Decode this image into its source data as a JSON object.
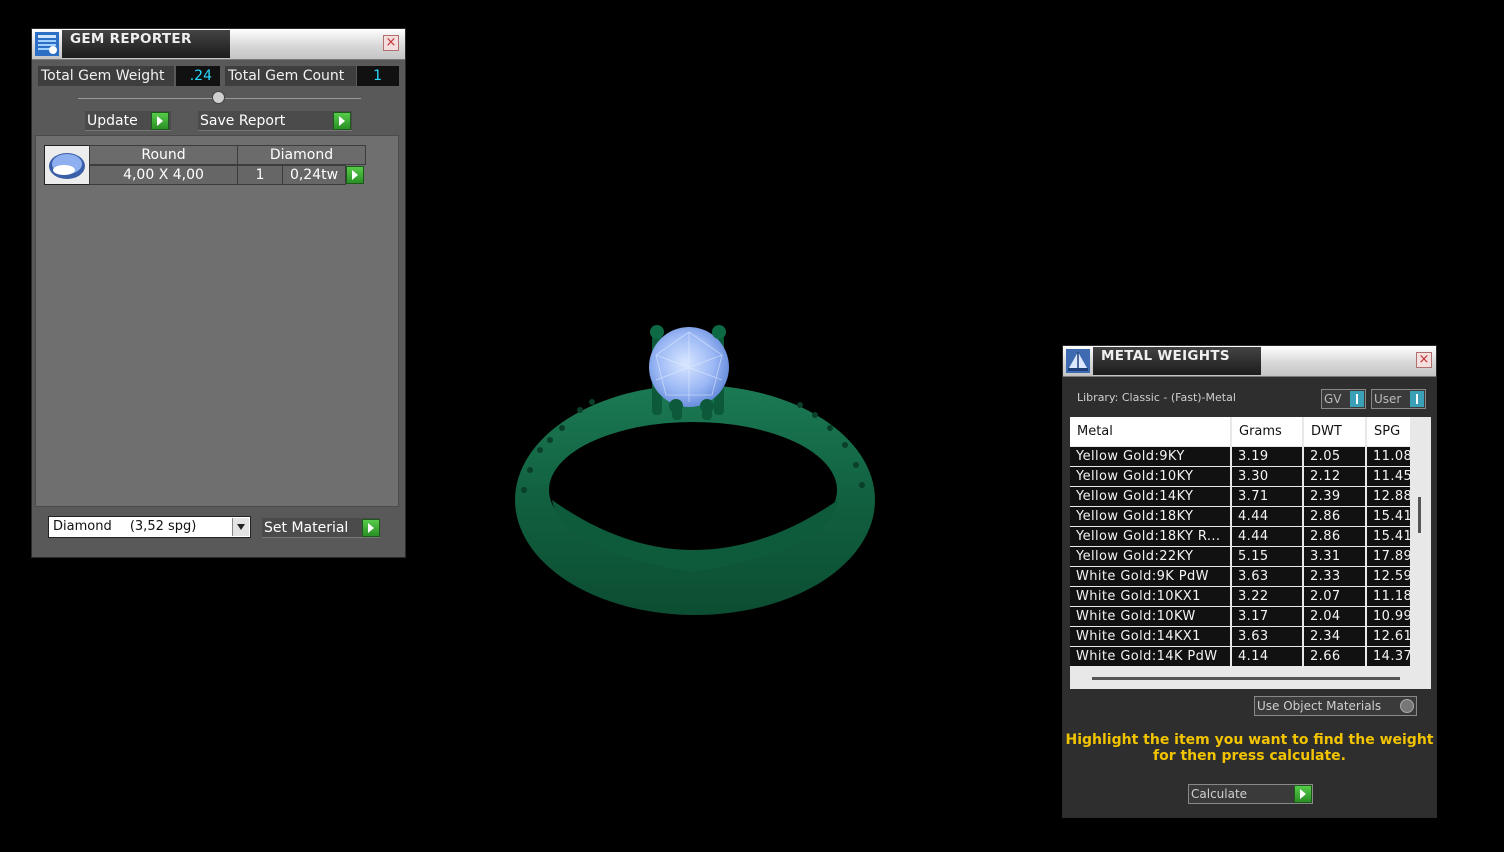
{
  "gem_reporter": {
    "title": "GEM REPORTER",
    "close": "×",
    "total_weight_label": "Total Gem Weight",
    "total_weight_value": ".24",
    "total_count_label": "Total Gem Count",
    "total_count_value": "1",
    "update_label": "Update",
    "save_report_label": "Save Report",
    "gem": {
      "shape": "Round",
      "material": "Diamond",
      "size": "4,00 X 4,00",
      "count": "1",
      "weight": "0,24tw"
    },
    "material_select": {
      "name": "Diamond",
      "spg": "(3,52 spg)"
    },
    "set_material_label": "Set Material"
  },
  "metal_weights": {
    "title": "METAL WEIGHTS",
    "close": "×",
    "library": "Library: Classic - (Fast)-Metal",
    "gv_label": "GV",
    "user_label": "User",
    "columns": [
      "Metal",
      "Grams",
      "DWT",
      "SPG"
    ],
    "rows": [
      [
        "Yellow Gold:9KY",
        "3.19",
        "2.05",
        "11.08"
      ],
      [
        "Yellow Gold:10KY",
        "3.30",
        "2.12",
        "11.45"
      ],
      [
        "Yellow Gold:14KY",
        "3.71",
        "2.39",
        "12.88"
      ],
      [
        "Yellow Gold:18KY",
        "4.44",
        "2.86",
        "15.41"
      ],
      [
        "Yellow Gold:18KY R...",
        "4.44",
        "2.86",
        "15.41"
      ],
      [
        "Yellow Gold:22KY",
        "5.15",
        "3.31",
        "17.89"
      ],
      [
        "White Gold:9K PdW",
        "3.63",
        "2.33",
        "12.59"
      ],
      [
        "White Gold:10KX1",
        "3.22",
        "2.07",
        "11.18"
      ],
      [
        "White Gold:10KW",
        "3.17",
        "2.04",
        "10.99"
      ],
      [
        "White Gold:14KX1",
        "3.63",
        "2.34",
        "12.61"
      ],
      [
        "White Gold:14K PdW",
        "4.14",
        "2.66",
        "14.37"
      ]
    ],
    "use_object_materials_label": "Use Object Materials",
    "hint_line1": "Highlight the item you want to find the weight",
    "hint_line2": "for then press calculate.",
    "calculate_label": "Calculate"
  }
}
